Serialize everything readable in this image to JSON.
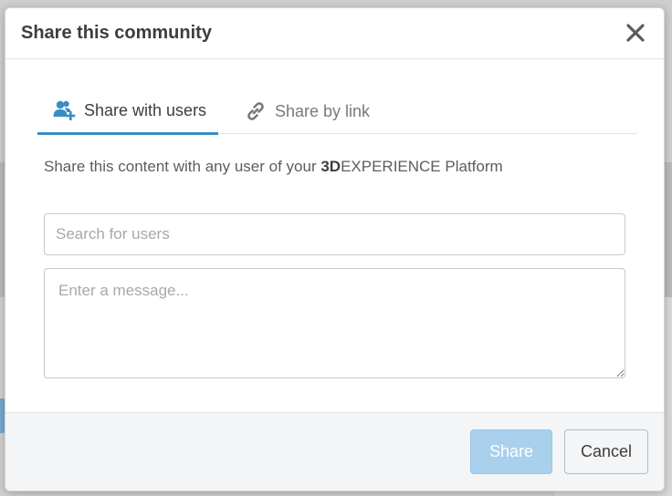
{
  "dialog": {
    "title": "Share this community"
  },
  "tabs": [
    {
      "label": "Share with users",
      "icon": "add-user-icon",
      "active": true
    },
    {
      "label": "Share by link",
      "icon": "link-icon",
      "active": false
    }
  ],
  "description": {
    "prefix": "Share this content with any user of your ",
    "brand_bold": "3D",
    "brand_rest": "EXPERIENCE",
    "suffix": " Platform"
  },
  "search": {
    "placeholder": "Search for users",
    "value": ""
  },
  "message": {
    "placeholder": "Enter a message...",
    "value": ""
  },
  "footer": {
    "share_label": "Share",
    "cancel_label": "Cancel"
  },
  "colors": {
    "accent": "#368ec4",
    "share_disabled": "#a9d0ec"
  }
}
